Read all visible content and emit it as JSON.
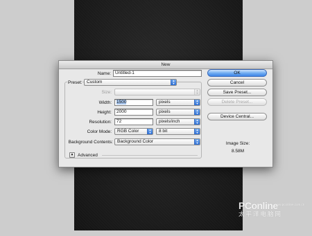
{
  "dialog": {
    "title": "New",
    "name_label": "Name:",
    "name_value": "Untitled-1",
    "preset_label": "Preset:",
    "preset_value": "Custom",
    "size_label": "Size:",
    "size_value": "",
    "width_label": "Width:",
    "width_value": "1500",
    "width_unit": "pixels",
    "height_label": "Height:",
    "height_value": "2000",
    "height_unit": "pixels",
    "resolution_label": "Resolution:",
    "resolution_value": "72",
    "resolution_unit": "pixels/inch",
    "color_mode_label": "Color Mode:",
    "color_mode_value": "RGB Color",
    "bit_depth_value": "8 bit",
    "background_label": "Background Contents:",
    "background_value": "Background Color",
    "advanced_label": "Advanced",
    "image_size_label": "Image Size:",
    "image_size_value": "8.58M"
  },
  "buttons": {
    "ok": "OK",
    "cancel": "Cancel",
    "save_preset": "Save Preset...",
    "delete_preset": "Delete Preset...",
    "device_central": "Device Central..."
  },
  "watermark": {
    "brand": "PConline",
    "url": "www.pconline.com.cn",
    "tagline": "太平洋电脑网"
  },
  "colors": {
    "accent": "#3f86e6",
    "canvas": "#1b1b1b",
    "background": "#cdcdcd"
  }
}
